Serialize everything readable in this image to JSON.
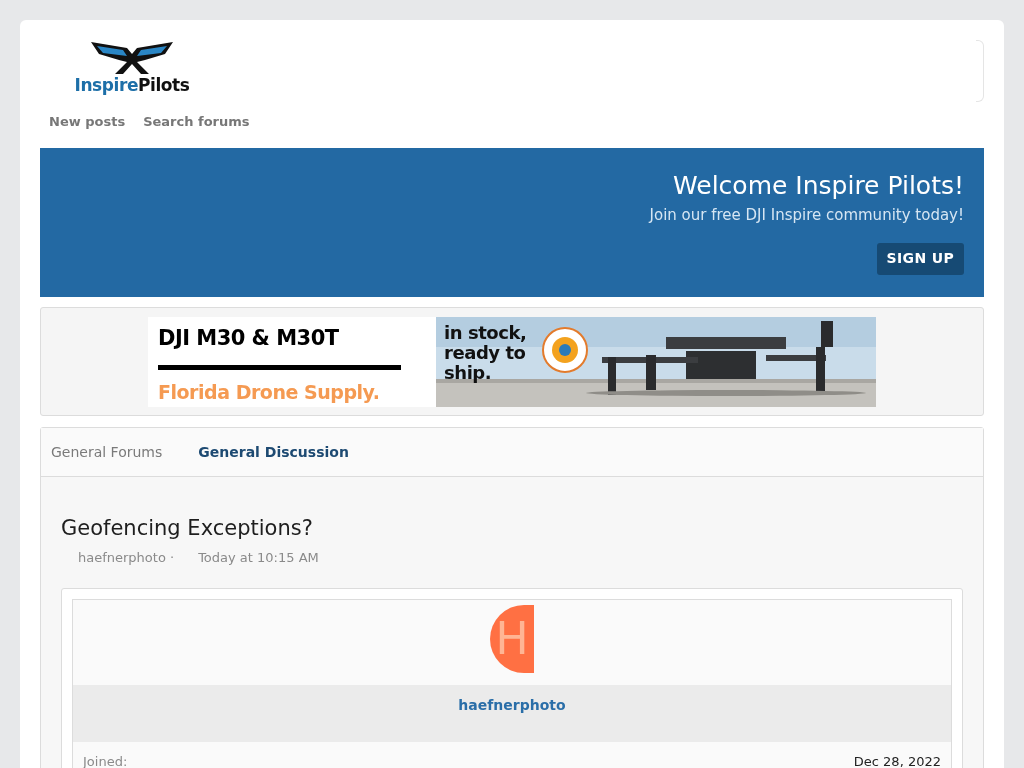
{
  "logo": {
    "part_1": "Inspire",
    "part_2": "Pilots"
  },
  "nav": [
    "New posts",
    "Search forums"
  ],
  "welcome": {
    "title": "Welcome Inspire Pilots!",
    "subtitle": "Join our free DJI Inspire community today!",
    "button": "SIGN UP"
  },
  "ad": {
    "headline": "DJI M30 & M30T",
    "brand": "Florida Drone Supply.",
    "tagline": "in stock,\nready to\nship."
  },
  "breadcrumbs": [
    {
      "label": "General Forums",
      "selected": false
    },
    {
      "label": "General Discussion",
      "selected": true
    }
  ],
  "thread": {
    "title": "Geofencing Exceptions?",
    "author": "haefnerphoto ·",
    "time": "Today at 10:15 AM"
  },
  "post": {
    "avatar_letter": "H",
    "username": "haefnerphoto",
    "stats": [
      {
        "label": "Joined:",
        "value": "Dec 28, 2022"
      }
    ]
  }
}
